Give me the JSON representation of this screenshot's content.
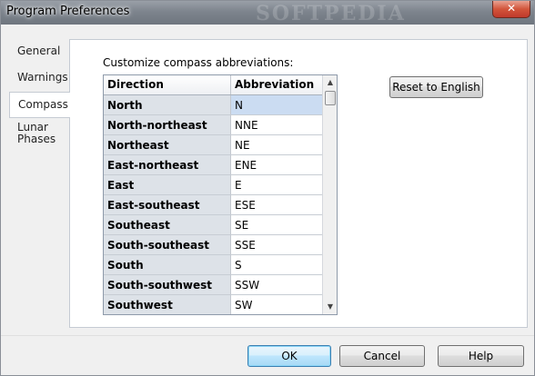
{
  "window": {
    "title": "Program Preferences",
    "titlebar_watermark": "SOFTPEDIA",
    "close_label": "✕"
  },
  "tabs": [
    {
      "label": "General"
    },
    {
      "label": "Warnings"
    },
    {
      "label": "Compass"
    },
    {
      "label_line1": "Lunar",
      "label_line2": "Phases"
    }
  ],
  "panel": {
    "label": "Customize compass abbreviations:",
    "reset_label": "Reset to English"
  },
  "grid": {
    "headers": [
      "Direction",
      "Abbreviation"
    ],
    "rows": [
      {
        "direction": "North",
        "abbreviation": "N"
      },
      {
        "direction": "North-northeast",
        "abbreviation": "NNE"
      },
      {
        "direction": "Northeast",
        "abbreviation": "NE"
      },
      {
        "direction": "East-northeast",
        "abbreviation": "ENE"
      },
      {
        "direction": "East",
        "abbreviation": "E"
      },
      {
        "direction": "East-southeast",
        "abbreviation": "ESE"
      },
      {
        "direction": "Southeast",
        "abbreviation": "SE"
      },
      {
        "direction": "South-southeast",
        "abbreviation": "SSE"
      },
      {
        "direction": "South",
        "abbreviation": "S"
      },
      {
        "direction": "South-southwest",
        "abbreviation": "SSW"
      },
      {
        "direction": "Southwest",
        "abbreviation": "SW"
      }
    ],
    "scroll_up": "▲",
    "scroll_down": "▼"
  },
  "buttons": {
    "ok": "OK",
    "cancel": "Cancel",
    "help": "Help"
  },
  "colors": {
    "selected_cell": "#cbdcf2",
    "header_cell": "#dde2e8",
    "default_button_border": "#3c7fb1"
  }
}
